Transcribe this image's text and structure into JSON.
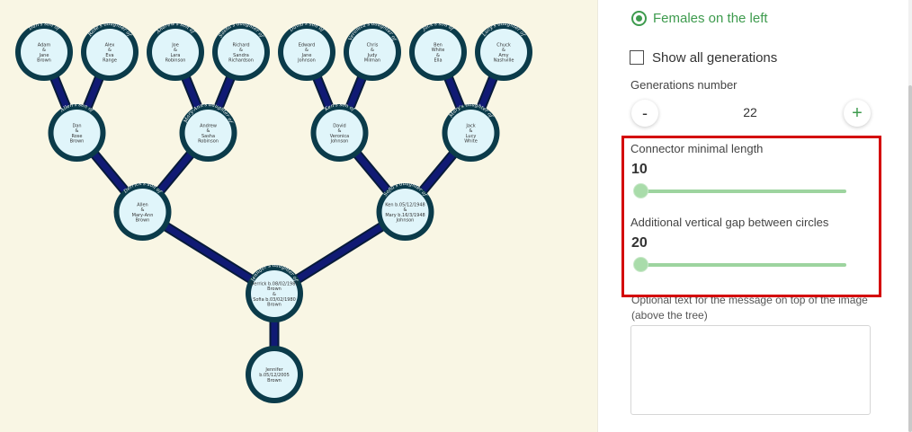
{
  "settings": {
    "females_left_label": "Females on the left",
    "show_all_label": "Show all generations",
    "generations_label": "Generations number",
    "generations_value": "22",
    "minus_label": "-",
    "plus_label": "+",
    "connector_label": "Connector minimal length",
    "connector_value": "10",
    "gap_label": "Additional vertical gap between circles",
    "gap_value": "20",
    "message_label": "Optional text for the message on top of the image (above the tree)",
    "message_value": ""
  },
  "colors": {
    "background": "#f9f6e4",
    "node_ring": "#0b3b4a",
    "node_fill": "#e0f5fa",
    "connector": "#101a74",
    "accent": "#3e9b4e",
    "slider": "#9dd49f",
    "highlight": "#d40000"
  },
  "tree": {
    "root": {
      "title": "",
      "lines": [
        "Jennifer",
        "b.05/12/2005",
        "Brown"
      ],
      "children": [
        {
          "title": "Jennifer's daughter of",
          "lines": [
            "Derrick b.08/02/1981",
            "Brown",
            "&",
            "Sofia b.03/02/1980",
            "Brown"
          ],
          "children": [
            {
              "title": "Derrick's son of",
              "lines": [
                "Allen",
                "&",
                "Mary-Ann",
                "Brown"
              ],
              "children": [
                {
                  "title": "Allen's son of",
                  "lines": [
                    "Dan",
                    "&",
                    "Rose",
                    "Brown"
                  ],
                  "children": [
                    {
                      "title": "Dan's son of",
                      "lines": [
                        "Adam",
                        "&",
                        "Jane",
                        "Brown"
                      ],
                      "children": []
                    },
                    {
                      "title": "Rose's daughter of",
                      "lines": [
                        "Alex",
                        "&",
                        "Eva",
                        "Range"
                      ],
                      "children": []
                    }
                  ]
                },
                {
                  "title": "Mary-Ann's daughter of",
                  "lines": [
                    "Andrew",
                    "&",
                    "Sasha",
                    "Robinson"
                  ],
                  "children": [
                    {
                      "title": "Andrew's son of",
                      "lines": [
                        "Joe",
                        "&",
                        "Lara",
                        "Robinson"
                      ],
                      "children": []
                    },
                    {
                      "title": "Sasha's daughter of",
                      "lines": [
                        "Richard",
                        "&",
                        "Sandra",
                        "Richardson"
                      ],
                      "children": []
                    }
                  ]
                }
              ]
            },
            {
              "title": "Sofia's daughter of",
              "lines": [
                "Ken b.05/12/1948",
                "&",
                "Mary b.16/3/1948",
                "Johnson"
              ],
              "children": [
                {
                  "title": "Ken's son of",
                  "lines": [
                    "David",
                    "&",
                    "Veronica",
                    "Johnson"
                  ],
                  "children": [
                    {
                      "title": "David's son of",
                      "lines": [
                        "Edward",
                        "&",
                        "Jane",
                        "Johnson"
                      ],
                      "children": []
                    },
                    {
                      "title": "Veronica's daughter of",
                      "lines": [
                        "Chris",
                        "&",
                        "Judy",
                        "Milman"
                      ],
                      "children": []
                    }
                  ]
                },
                {
                  "title": "Mary's daughter of",
                  "lines": [
                    "Jack",
                    "&",
                    "Lucy",
                    "White"
                  ],
                  "children": [
                    {
                      "title": "Jack's son of",
                      "lines": [
                        "Ben",
                        "White",
                        "&",
                        "Ella"
                      ],
                      "children": []
                    },
                    {
                      "title": "Lucy's daughter of",
                      "lines": [
                        "Chuck",
                        "&",
                        "Amy",
                        "Nashville"
                      ],
                      "children": []
                    }
                  ]
                }
              ]
            }
          ]
        }
      ]
    }
  }
}
